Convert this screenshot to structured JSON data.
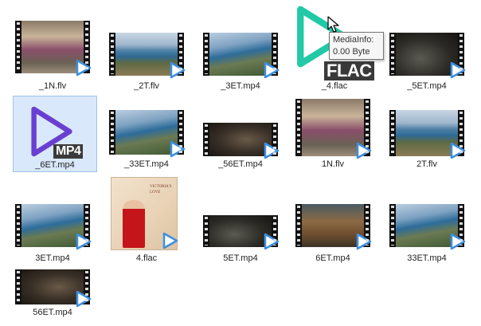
{
  "files": [
    {
      "name": "_1N.flv",
      "kind": "video",
      "scene": "room"
    },
    {
      "name": "_2T.flv",
      "kind": "video",
      "scene": "beach"
    },
    {
      "name": "_3ET.mp4",
      "kind": "video",
      "scene": "beach2"
    },
    {
      "name": "_4.flac",
      "kind": "bigplay",
      "badge": "FLAC",
      "color": "#22c9a6"
    },
    {
      "name": "_5ET.mp4",
      "kind": "video",
      "scene": "dark"
    },
    {
      "name": "_6ET.mp4",
      "kind": "bigplay",
      "badge": "MP4",
      "color": "#6a3fd0",
      "selected": true
    },
    {
      "name": "_33ET.mp4",
      "kind": "video",
      "scene": "beach2"
    },
    {
      "name": "_56ET.mp4",
      "kind": "video",
      "scene": "dark2"
    },
    {
      "name": "1N.flv",
      "kind": "video",
      "scene": "room"
    },
    {
      "name": "2T.flv",
      "kind": "video",
      "scene": "beach"
    },
    {
      "name": "3ET.mp4",
      "kind": "video",
      "scene": "beach2"
    },
    {
      "name": "4.flac",
      "kind": "cover"
    },
    {
      "name": "5ET.mp4",
      "kind": "video",
      "scene": "dark"
    },
    {
      "name": "6ET.mp4",
      "kind": "video",
      "scene": "crab"
    },
    {
      "name": "33ET.mp4",
      "kind": "video",
      "scene": "beach2"
    },
    {
      "name": "56ET.mp4",
      "kind": "video",
      "scene": "dark2"
    }
  ],
  "tooltip": {
    "line1": "MediaInfo:",
    "line2": "0.00 Byte"
  },
  "cover_art": {
    "line1": "VICTORIA'S LOVE"
  },
  "colors": {
    "play_accent": "#3d8fe0",
    "selection_bg": "#d9e8fb",
    "selection_border": "#9ec3f0"
  },
  "icons": {
    "video_overlay": "play-triangle-icon",
    "cursor": "mouse-pointer-icon"
  }
}
